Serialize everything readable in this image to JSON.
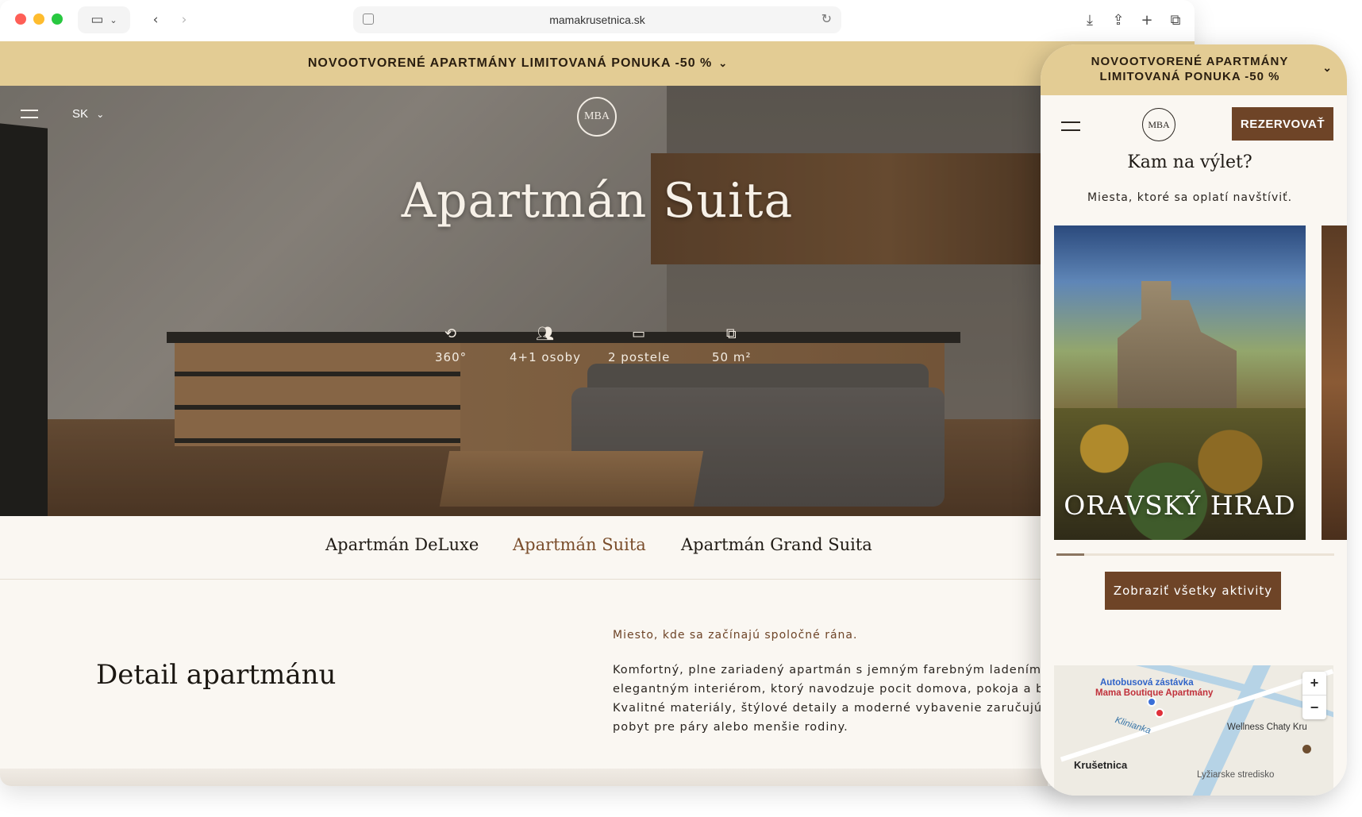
{
  "browser": {
    "url": "mamakrusetnica.sk",
    "icons": {
      "sidebar": "sidebar-icon",
      "back": "chevron-left-icon",
      "forward": "chevron-right-icon",
      "reload": "reload-icon",
      "download": "download-icon",
      "share": "share-icon",
      "new_tab": "plus-icon",
      "tabs": "tabs-icon"
    }
  },
  "promo": {
    "text": "NOVOOTVORENÉ APARTMÁNY LIMITOVANÁ PONUKA -50 %"
  },
  "header": {
    "lang": "SK",
    "logo_text": "MBA"
  },
  "hero": {
    "title": "Apartmán Suita",
    "features": [
      {
        "label": "360°",
        "icon": "camera-360-icon"
      },
      {
        "label": "4+1 osoby",
        "icon": "people-icon"
      },
      {
        "label": "2 postele",
        "icon": "bed-icon"
      },
      {
        "label": "50 m²",
        "icon": "area-icon"
      }
    ]
  },
  "apartment_tabs": [
    {
      "label": "Apartmán DeLuxe",
      "active": false
    },
    {
      "label": "Apartmán Suita",
      "active": true
    },
    {
      "label": "Apartmán Grand Suita",
      "active": false
    }
  ],
  "detail": {
    "title": "Detail apartmánu",
    "subtitle": "Miesto, kde sa začínajú spoločné rána.",
    "lines": [
      "Komfortný, plne zariadený apartmán s jemným farebným ladením a",
      "elegantným interiérom, ktorý navodzuje pocit domova, pokoja a bez",
      "Kvalitné materiály, štýlové detaily a moderné vybavenie zaručujú poh",
      "pobyt pre páry alebo menšie rodiny."
    ]
  },
  "mobile": {
    "promo_text": "NOVOOTVORENÉ APARTMÁNY LIMITOVANÁ PONUKA -50 %",
    "book_label": "REZERVOVAŤ",
    "logo_text": "MBA",
    "heading": "Kam na výlet?",
    "subheading": "Miesta, ktoré sa oplatí navštíviť.",
    "card_title": "ORAVSKÝ HRAD",
    "carousel_progress": 0.1,
    "all_activities_label": "Zobraziť všetky aktivity",
    "map": {
      "labels": {
        "bus_stop": "Autobusová zástávka",
        "place": "Mama Boutique Apartmány",
        "river": "Klinianka",
        "wellness": "Wellness Chaty Kru",
        "village": "Krušetnica",
        "bottom": "Lyžiarske stredisko"
      },
      "zoom_in": "+",
      "zoom_out": "−"
    }
  },
  "colors": {
    "promo_bg": "#e3cc94",
    "brand_brown": "#6e4427",
    "page_bg": "#faf7f2"
  }
}
